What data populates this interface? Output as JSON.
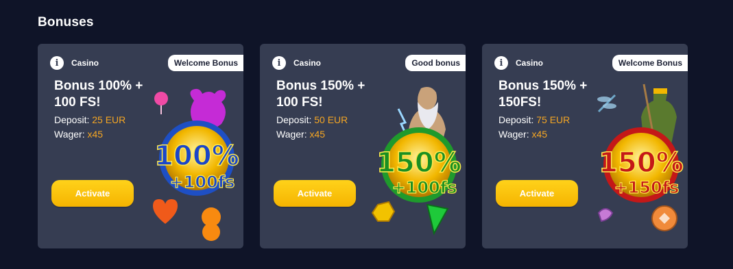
{
  "section": {
    "title": "Bonuses"
  },
  "cards": [
    {
      "category": "Casino",
      "badge": "Welcome Bonus",
      "title": "Bonus 100% + 100 FS!",
      "deposit_label": "Deposit:",
      "deposit_value": "25 EUR",
      "wager_label": "Wager:",
      "wager_value": "x45",
      "button": "Activate",
      "art_line1": "100%",
      "art_line2": "+100fs"
    },
    {
      "category": "Casino",
      "badge": "Good bonus",
      "title": "Bonus 150% + 100 FS!",
      "deposit_label": "Deposit:",
      "deposit_value": "50 EUR",
      "wager_label": "Wager:",
      "wager_value": "x45",
      "button": "Activate",
      "art_line1": "150%",
      "art_line2": "+100fs"
    },
    {
      "category": "Casino",
      "badge": "Welcome Bonus",
      "title": "Bonus 150% + 150FS!",
      "deposit_label": "Deposit:",
      "deposit_value": "75 EUR",
      "wager_label": "Wager:",
      "wager_value": "x45",
      "button": "Activate",
      "art_line1": "150%",
      "art_line2": "+150fs"
    }
  ],
  "colors": {
    "background": "#0f1428",
    "card": "#363d52",
    "accent_value": "#f5a623",
    "button": "#ffc800"
  }
}
